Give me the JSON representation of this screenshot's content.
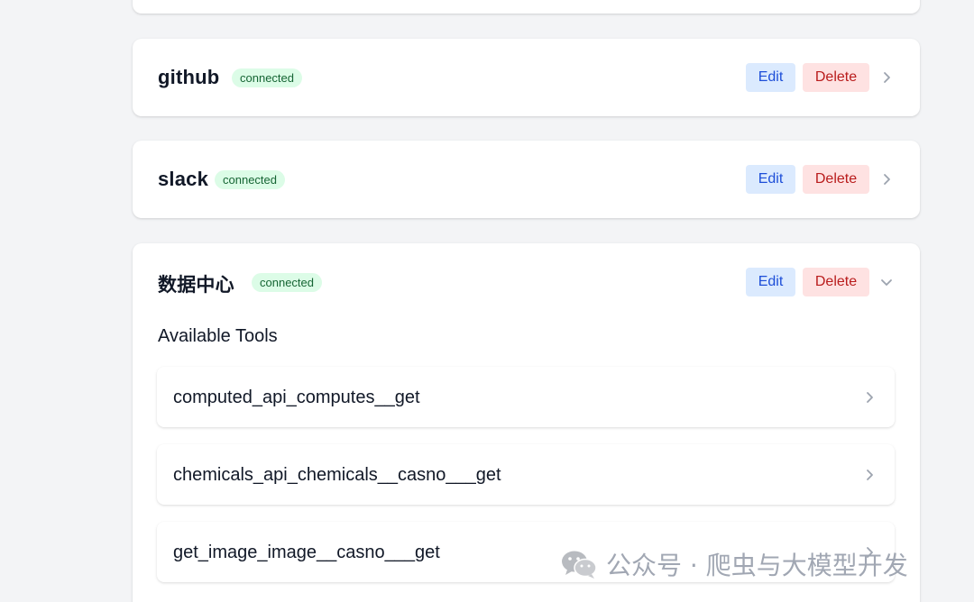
{
  "servers": [
    {
      "name": "github",
      "status": "connected",
      "edit_label": "Edit",
      "delete_label": "Delete",
      "expanded": false
    },
    {
      "name": "slack",
      "status": "connected",
      "edit_label": "Edit",
      "delete_label": "Delete",
      "expanded": false
    },
    {
      "name": "数据中心",
      "status": "connected",
      "edit_label": "Edit",
      "delete_label": "Delete",
      "expanded": true,
      "section_title": "Available Tools",
      "tools": [
        {
          "name": "computed_api_computes__get"
        },
        {
          "name": "chemicals_api_chemicals__casno___get"
        },
        {
          "name": "get_image_image__casno___get"
        }
      ]
    }
  ],
  "watermark": {
    "text": "公众号 · 爬虫与大模型开发",
    "icon": "wechat-icon"
  },
  "colors": {
    "page_bg": "#f3f4f6",
    "badge_bg": "#dcfce7",
    "badge_text": "#166534",
    "edit_bg": "#dbeafe",
    "edit_text": "#1d4ed8",
    "delete_bg": "#fee2e2",
    "delete_text": "#b91c1c"
  }
}
